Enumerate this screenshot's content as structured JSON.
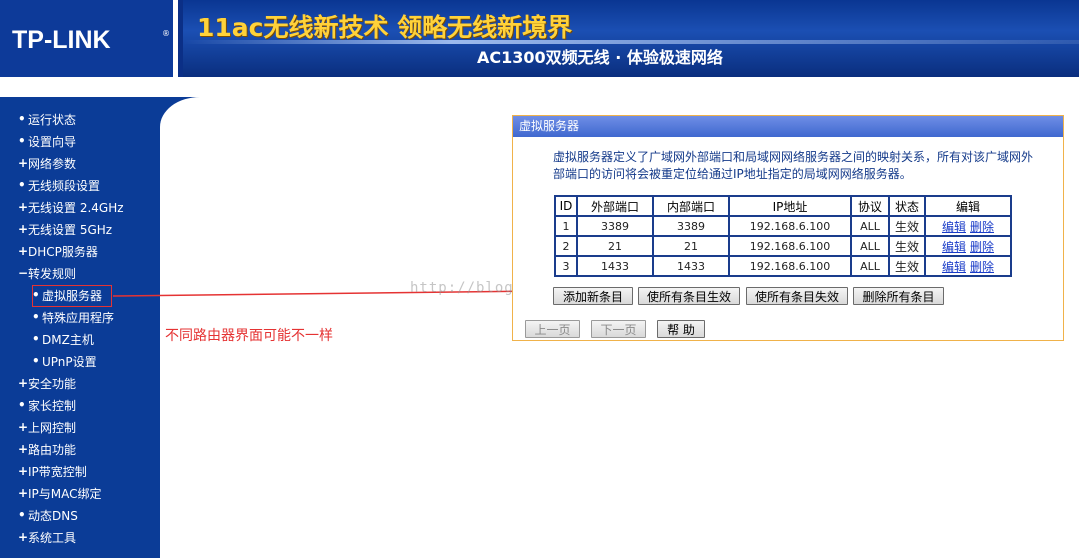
{
  "banner": {
    "logo": "TP-LINK",
    "logo_reg": "®",
    "slogan": "11ac无线新技术 领略无线新境界",
    "subtitle": "AC1300双频无线 · 体验极速网络"
  },
  "sidebar": {
    "items": [
      {
        "mark": "•",
        "label": "运行状态"
      },
      {
        "mark": "•",
        "label": "设置向导"
      },
      {
        "mark": "+",
        "label": "网络参数"
      },
      {
        "mark": "•",
        "label": "无线频段设置"
      },
      {
        "mark": "+",
        "label": "无线设置 2.4GHz"
      },
      {
        "mark": "+",
        "label": "无线设置 5GHz"
      },
      {
        "mark": "+",
        "label": "DHCP服务器"
      },
      {
        "mark": "−",
        "label": "转发规则"
      },
      {
        "mark": "•",
        "label": "虚拟服务器"
      },
      {
        "mark": "•",
        "label": "特殊应用程序"
      },
      {
        "mark": "•",
        "label": "DMZ主机"
      },
      {
        "mark": "•",
        "label": "UPnP设置"
      },
      {
        "mark": "+",
        "label": "安全功能"
      },
      {
        "mark": "•",
        "label": "家长控制"
      },
      {
        "mark": "+",
        "label": "上网控制"
      },
      {
        "mark": "+",
        "label": "路由功能"
      },
      {
        "mark": "+",
        "label": "IP带宽控制"
      },
      {
        "mark": "+",
        "label": "IP与MAC绑定"
      },
      {
        "mark": "•",
        "label": "动态DNS"
      },
      {
        "mark": "+",
        "label": "系统工具"
      }
    ]
  },
  "annotation": "不同路由器界面可能不一样",
  "watermark": "http://blog.",
  "panel": {
    "title": "虚拟服务器",
    "description": "虚拟服务器定义了广域网外部端口和局域网网络服务器之间的映射关系，所有对该广域网外部端口的访问将会被重定位给通过IP地址指定的局域网网络服务器。",
    "table": {
      "headers": [
        "ID",
        "外部端口",
        "内部端口",
        "IP地址",
        "协议",
        "状态",
        "编辑"
      ],
      "rows": [
        {
          "id": "1",
          "ext": "3389",
          "int": "3389",
          "ip": "192.168.6.100",
          "proto": "ALL",
          "status": "生效",
          "edit": "编辑",
          "del": "删除"
        },
        {
          "id": "2",
          "ext": "21",
          "int": "21",
          "ip": "192.168.6.100",
          "proto": "ALL",
          "status": "生效",
          "edit": "编辑",
          "del": "删除"
        },
        {
          "id": "3",
          "ext": "1433",
          "int": "1433",
          "ip": "192.168.6.100",
          "proto": "ALL",
          "status": "生效",
          "edit": "编辑",
          "del": "删除"
        }
      ]
    },
    "buttons": {
      "add": "添加新条目",
      "enable_all": "使所有条目生效",
      "disable_all": "使所有条目失效",
      "delete_all": "删除所有条目",
      "prev": "上一页",
      "next": "下一页",
      "help": "帮 助"
    }
  },
  "colors": {
    "nav_bg": "#0b3c97",
    "annotation_red": "#e53333",
    "table_border": "#1a3c8c",
    "panel_border": "#f0b24a",
    "slogan_yellow": "#ffd23a"
  }
}
